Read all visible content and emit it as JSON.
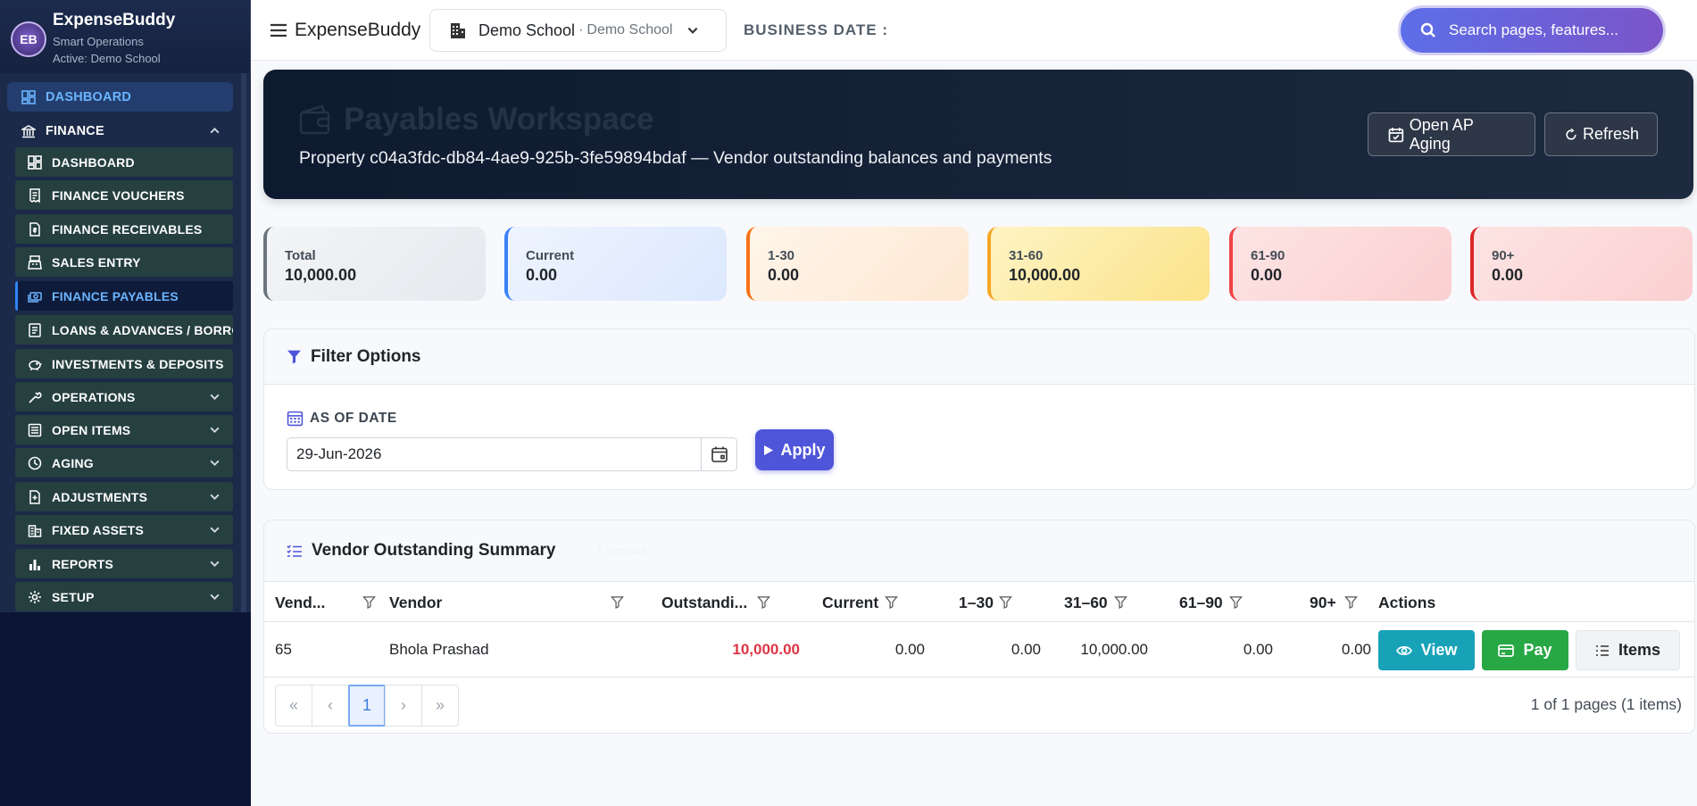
{
  "sidebar": {
    "brand": "ExpenseBuddy",
    "logo_text": "EB",
    "subtitle": "Smart Operations",
    "active_line": "Active: Demo School",
    "items": [
      {
        "label": "DASHBOARD",
        "icon": "dashboard-icon"
      },
      {
        "label": "FINANCE",
        "icon": "bank-icon"
      },
      {
        "label": "DASHBOARD",
        "icon": "dashboard-icon"
      },
      {
        "label": "FINANCE VOUCHERS",
        "icon": "receipt-icon"
      },
      {
        "label": "FINANCE RECEIVABLES",
        "icon": "file-money-icon"
      },
      {
        "label": "SALES ENTRY",
        "icon": "register-icon"
      },
      {
        "label": "FINANCE PAYABLES",
        "icon": "cash-icon"
      },
      {
        "label": "LOANS & ADVANCES / BORROWINGS",
        "icon": "ledger-icon"
      },
      {
        "label": "INVESTMENTS & DEPOSITS",
        "icon": "piggy-icon"
      },
      {
        "label": "OPERATIONS",
        "icon": "tools-icon"
      },
      {
        "label": "OPEN ITEMS",
        "icon": "list-icon"
      },
      {
        "label": "AGING",
        "icon": "clock-icon"
      },
      {
        "label": "ADJUSTMENTS",
        "icon": "adjust-icon"
      },
      {
        "label": "FIXED ASSETS",
        "icon": "building-icon"
      },
      {
        "label": "REPORTS",
        "icon": "bar-chart-icon"
      },
      {
        "label": "SETUP",
        "icon": "gear-icon"
      }
    ]
  },
  "topbar": {
    "brand": "ExpenseBuddy",
    "school_name": "Demo School",
    "school_separator": "·",
    "school_sub": "Demo School",
    "business_date_label": "BUSINESS DATE :",
    "search_placeholder": "Search pages, features..."
  },
  "hero": {
    "title": "Payables Workspace",
    "subtitle": "Property c04a3fdc-db84-4ae9-925b-3fe59894bdaf — Vendor outstanding balances and payments",
    "btn_aging": "Open AP Aging",
    "btn_refresh": "Refresh"
  },
  "cards": [
    {
      "label": "Total",
      "value": "10,000.00",
      "accent": "#6c757d"
    },
    {
      "label": "Current",
      "value": "0.00",
      "accent": "#3b82f6"
    },
    {
      "label": "1-30",
      "value": "0.00",
      "accent": "#f97316"
    },
    {
      "label": "31-60",
      "value": "10,000.00",
      "accent": "#f5a623"
    },
    {
      "label": "61-90",
      "value": "0.00",
      "accent": "#ef4444"
    },
    {
      "label": "90+",
      "value": "0.00",
      "accent": "#dc2626"
    }
  ],
  "filter": {
    "title": "Filter Options",
    "as_of_label": "AS OF DATE",
    "date_value": "29-Jun-2026",
    "apply": "Apply"
  },
  "vendor": {
    "title": "Vendor Outstanding Summary",
    "badge": "1 vendors",
    "columns": [
      "Vend...",
      "Vendor",
      "Outstandi...",
      "Current",
      "1–30",
      "31–60",
      "61–90",
      "90+",
      "Actions"
    ],
    "rows": [
      {
        "id": "65",
        "name": "Bhola Prashad",
        "outstanding": "10,000.00",
        "current": "0.00",
        "d1_30": "0.00",
        "d31_60": "10,000.00",
        "d61_90": "0.00",
        "d90p": "0.00"
      }
    ],
    "actions": {
      "view": "View",
      "pay": "Pay",
      "items": "Items"
    },
    "pager": {
      "first": "«",
      "prev": "‹",
      "page": "1",
      "next": "›",
      "last": "»",
      "info": "1 of 1 pages (1 items)"
    }
  },
  "colors": {
    "accent": "#4e55d9",
    "view": "#17a2b8",
    "pay": "#28a745",
    "danger": "#dc3545"
  }
}
